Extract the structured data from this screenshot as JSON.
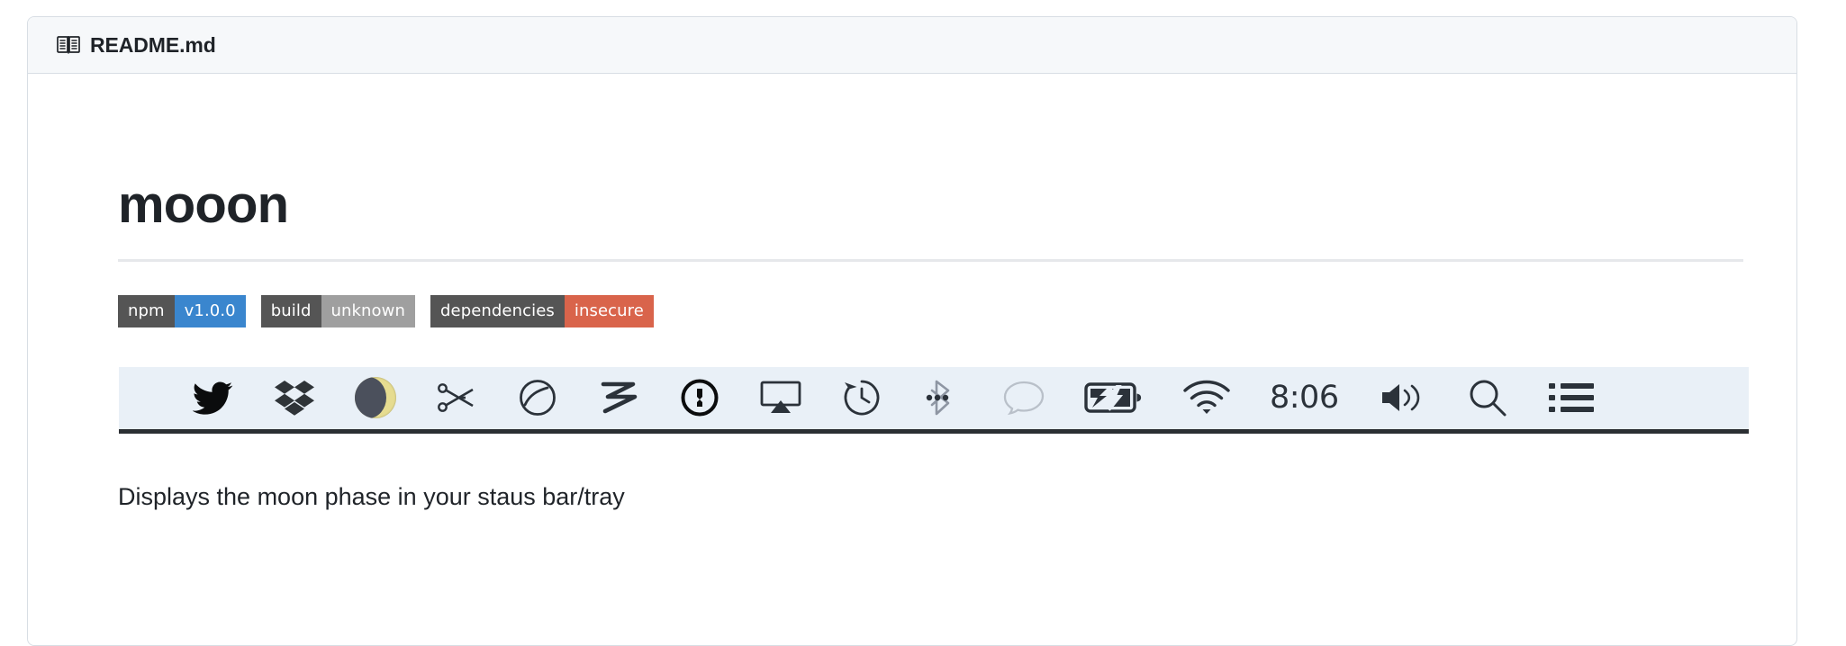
{
  "card": {
    "header": {
      "icon": "book-icon",
      "title": "README.md"
    }
  },
  "readme": {
    "heading": "mooon",
    "description": "Displays the moon phase in your staus bar/tray",
    "badges": [
      {
        "name": "npm-version-badge",
        "label": "npm",
        "value": "v1.0.0",
        "label_color": "#555555",
        "value_color": "#3a86ce"
      },
      {
        "name": "build-status-badge",
        "label": "build",
        "value": "unknown",
        "label_color": "#555555",
        "value_color": "#9f9f9f"
      },
      {
        "name": "dependencies-badge",
        "label": "dependencies",
        "value": "insecure",
        "label_color": "#555555",
        "value_color": "#d9644b"
      }
    ],
    "statusbar": {
      "background": "#e9f0f7",
      "border_color": "#2b2f33",
      "clock": "8:06",
      "items": [
        {
          "name": "twitter-icon",
          "kind": "icon"
        },
        {
          "name": "dropbox-icon",
          "kind": "icon"
        },
        {
          "name": "moon-phase-icon",
          "kind": "moon"
        },
        {
          "name": "scissors-icon",
          "kind": "icon"
        },
        {
          "name": "circle-swoosh-icon",
          "kind": "icon"
        },
        {
          "name": "zigzag-icon",
          "kind": "icon"
        },
        {
          "name": "onepassword-icon",
          "kind": "icon"
        },
        {
          "name": "airplay-icon",
          "kind": "icon"
        },
        {
          "name": "time-machine-icon",
          "kind": "icon"
        },
        {
          "name": "bluetooth-icon",
          "kind": "icon"
        },
        {
          "name": "messages-icon",
          "kind": "icon"
        },
        {
          "name": "battery-charging-icon",
          "kind": "icon"
        },
        {
          "name": "wifi-icon",
          "kind": "icon"
        },
        {
          "name": "clock-time",
          "kind": "text"
        },
        {
          "name": "volume-icon",
          "kind": "icon"
        },
        {
          "name": "spotlight-search-icon",
          "kind": "icon"
        },
        {
          "name": "notification-center-icon",
          "kind": "icon"
        }
      ]
    }
  },
  "colors": {
    "card_border": "#d8dee4",
    "header_bg": "#f6f8fa",
    "text": "#1f2328",
    "rule": "#e6e8eb"
  }
}
